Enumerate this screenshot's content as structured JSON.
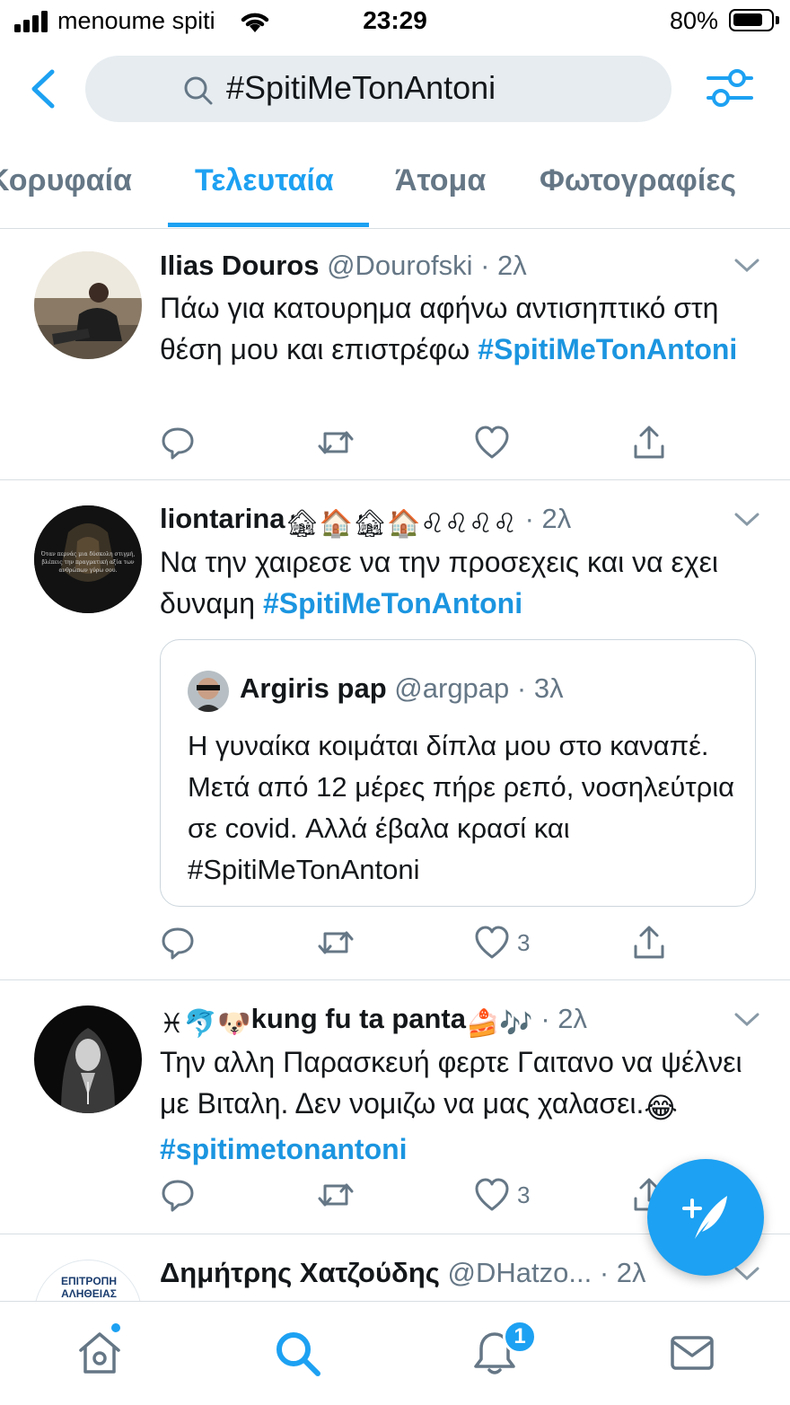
{
  "status_bar": {
    "carrier": "menoume spiti",
    "time": "23:29",
    "battery": "80%",
    "battery_level": 0.8
  },
  "search": {
    "query": "#SpitiMeTonAntoni"
  },
  "tabs": [
    {
      "label": "Κορυφαία",
      "active": false
    },
    {
      "label": "Τελευταία",
      "active": true
    },
    {
      "label": "Άτομα",
      "active": false
    },
    {
      "label": "Φωτογραφίες",
      "active": false
    }
  ],
  "tweets": [
    {
      "name": "Ilias Douros",
      "handle": "@Dourofski",
      "time": "· 2λ",
      "text": "Πάω για κατουρημα αφήνω αντισηπτικό στη θέση μου και επιστρέφω ",
      "hashtag": "#SpitiMeTonAntoni",
      "likes": ""
    },
    {
      "name": "liontarina",
      "name_emoji": "🏚🏠🏚🏠♌♌♌♌",
      "handle": "",
      "time": "· 2λ",
      "text": "Να την χαιρεσε να την προσεχεις και να εχει δυναμη ",
      "hashtag": "#SpitiMeTonAntoni",
      "avatar_text": "Όταν περνάς μια δύσκολη στιγμή, βλέπεις την πραγματική αξία των ανθρώπων γύρω σου.",
      "likes": "3",
      "quote": {
        "name": "Argiris pap",
        "handle": "@argpap",
        "time": "· 3λ",
        "text": "Η γυναίκα κοιμάται δίπλα μου στο καναπέ. Μετά από 12 μέρες πήρε ρεπό, νοσηλεύτρια σε covid. Αλλά έβαλα κρασί και #SpitiMeTonAntoni"
      }
    },
    {
      "name_prefix": "♓🐬🐶",
      "name": "kung fu ta panta",
      "name_suffix": "🍰🎶",
      "handle": "",
      "time": "· 2λ",
      "text": "Την αλλη Παρασκευή φερτε Γαιτανο να ψέλνει με Βιταλη. Δεν νομιζω να μας χαλασει.",
      "text_emoji": "😂",
      "hashtag": "#spitimetonantoni",
      "likes": "3"
    },
    {
      "name": "Δημήτρης Χατζούδης",
      "handle": "@DHatzo...",
      "time": "· 2λ",
      "avatar_text": "ΕΠΙΤΡΟΠΗ ΑΛΗΘΕΙΑΣ"
    }
  ],
  "bottom_nav": {
    "notifications_badge": "1",
    "items": [
      "home-icon",
      "search-icon",
      "bell-icon",
      "mail-icon"
    ]
  },
  "colors": {
    "accent": "#1da1f2",
    "hashtag": "#1b95e0",
    "muted": "#657786",
    "search_bg": "#e6ecf0"
  }
}
